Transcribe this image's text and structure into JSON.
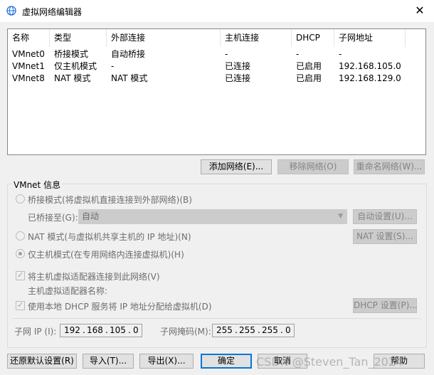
{
  "window": {
    "title": "虚拟网络编辑器",
    "close": "✕"
  },
  "table": {
    "headers": [
      "名称",
      "类型",
      "外部连接",
      "主机连接",
      "DHCP",
      "子网地址"
    ],
    "rows": [
      [
        "VMnet0",
        "桥接模式",
        "自动桥接",
        "-",
        "-",
        "-"
      ],
      [
        "VMnet1",
        "仅主机模式",
        "-",
        "已连接",
        "已启用",
        "192.168.105.0"
      ],
      [
        "VMnet8",
        "NAT 模式",
        "NAT 模式",
        "已连接",
        "已启用",
        "192.168.129.0"
      ]
    ]
  },
  "network_buttons": {
    "add": "添加网络(E)...",
    "remove": "移除网络(O)",
    "rename": "重命名网络(W)..."
  },
  "vmnet_info": {
    "label": "VMnet 信息",
    "bridged_radio": "桥接模式(将虚拟机直接连接到外部网络)(B)",
    "bridged_to_label": "已桥接至(G):",
    "bridged_to_value": "自动",
    "auto_settings": "自动设置(U)...",
    "nat_radio": "NAT 模式(与虚拟机共享主机的 IP 地址)(N)",
    "nat_settings": "NAT 设置(S)...",
    "hostonly_radio": "仅主机模式(在专用网络内连接虚拟机)(H)",
    "connect_adapter_check": "将主机虚拟适配器连接到此网络(V)",
    "adapter_name_label": "主机虚拟适配器名称:",
    "dhcp_check": "使用本地 DHCP 服务将 IP 地址分配给虚拟机(D)",
    "dhcp_settings": "DHCP 设置(P)...",
    "subnet_ip_label": "子网 IP (I):",
    "subnet_ip": [
      "192",
      "168",
      "105",
      "0"
    ],
    "subnet_mask_label": "子网掩码(M):",
    "subnet_mask": [
      "255",
      "255",
      "255",
      "0"
    ]
  },
  "footer": {
    "restore": "还原默认设置(R)",
    "import": "导入(T)...",
    "export": "导出(X)...",
    "ok": "确定",
    "cancel": "取消",
    "help": "帮助"
  },
  "watermark": "CSDN @Steven_Tan_2024",
  "colors": {
    "accent": "#0078d7",
    "disabled_text": "#6d6d6d",
    "title_icon": "#1e6fd9"
  }
}
